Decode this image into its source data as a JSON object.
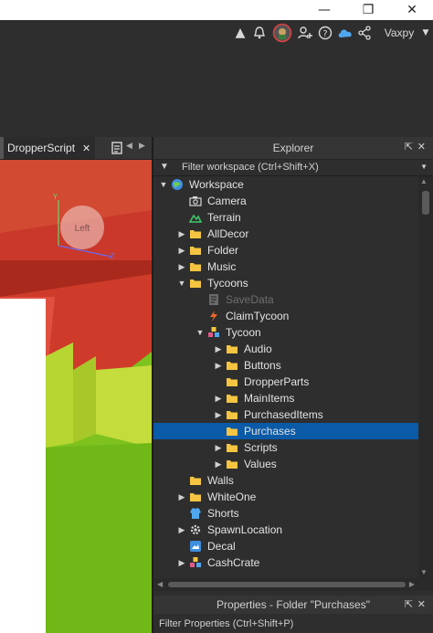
{
  "window": {
    "minimize_glyph": "—",
    "maximize_glyph": "❐",
    "close_glyph": "✕"
  },
  "toolbar": {
    "username": "Vaxpy",
    "icons": [
      "chevron-up-icon",
      "notification-bell-icon",
      "avatar-icon",
      "add-friend-icon",
      "help-icon",
      "cloud-icon",
      "share-icon",
      "chevron-down-icon"
    ]
  },
  "document_tabs": {
    "active_tab": "DropperScript",
    "close_glyph": "✕"
  },
  "viewport": {
    "view_cube_face": "Left",
    "axis_y": "Y",
    "axis_z": "Z"
  },
  "explorer": {
    "title": "Explorer",
    "filter_placeholder": "Filter workspace (Ctrl+Shift+X)",
    "items": [
      {
        "label": "Workspace",
        "icon": "workspace-globe-icon",
        "depth": 0,
        "arrow": "expanded"
      },
      {
        "label": "Camera",
        "icon": "camera-icon",
        "depth": 1,
        "arrow": "none"
      },
      {
        "label": "Terrain",
        "icon": "terrain-icon",
        "depth": 1,
        "arrow": "none"
      },
      {
        "label": "AllDecor",
        "icon": "folder-icon",
        "depth": 1,
        "arrow": "collapsed"
      },
      {
        "label": "Folder",
        "icon": "folder-icon",
        "depth": 1,
        "arrow": "collapsed"
      },
      {
        "label": "Music",
        "icon": "folder-icon",
        "depth": 1,
        "arrow": "collapsed"
      },
      {
        "label": "Tycoons",
        "icon": "folder-icon",
        "depth": 1,
        "arrow": "expanded"
      },
      {
        "label": "SaveData",
        "icon": "script-disabled-icon",
        "depth": 2,
        "arrow": "none",
        "dim": true
      },
      {
        "label": "ClaimTycoon",
        "icon": "lightning-script-icon",
        "depth": 2,
        "arrow": "none"
      },
      {
        "label": "Tycoon",
        "icon": "model-icon",
        "depth": 2,
        "arrow": "expanded"
      },
      {
        "label": "Audio",
        "icon": "folder-icon",
        "depth": 3,
        "arrow": "collapsed"
      },
      {
        "label": "Buttons",
        "icon": "folder-icon",
        "depth": 3,
        "arrow": "collapsed"
      },
      {
        "label": "DropperParts",
        "icon": "folder-icon",
        "depth": 3,
        "arrow": "none"
      },
      {
        "label": "MainItems",
        "icon": "folder-icon",
        "depth": 3,
        "arrow": "collapsed"
      },
      {
        "label": "PurchasedItems",
        "icon": "folder-icon",
        "depth": 3,
        "arrow": "collapsed"
      },
      {
        "label": "Purchases",
        "icon": "folder-icon",
        "depth": 3,
        "arrow": "none",
        "selected": true
      },
      {
        "label": "Scripts",
        "icon": "folder-icon",
        "depth": 3,
        "arrow": "collapsed"
      },
      {
        "label": "Values",
        "icon": "folder-icon",
        "depth": 3,
        "arrow": "collapsed"
      },
      {
        "label": "Walls",
        "icon": "folder-icon",
        "depth": 1,
        "arrow": "none"
      },
      {
        "label": "WhiteOne",
        "icon": "folder-icon",
        "depth": 1,
        "arrow": "collapsed"
      },
      {
        "label": "Shorts",
        "icon": "spawn-shirt-icon",
        "depth": 1,
        "arrow": "none"
      },
      {
        "label": "SpawnLocation",
        "icon": "gear-icon",
        "depth": 1,
        "arrow": "collapsed"
      },
      {
        "label": "Decal",
        "icon": "decal-icon",
        "depth": 1,
        "arrow": "none"
      },
      {
        "label": "CashCrate",
        "icon": "model-icon",
        "depth": 1,
        "arrow": "collapsed"
      }
    ]
  },
  "properties": {
    "title": "Properties - Folder \"Purchases\"",
    "filter_placeholder": "Filter Properties (Ctrl+Shift+P)"
  }
}
